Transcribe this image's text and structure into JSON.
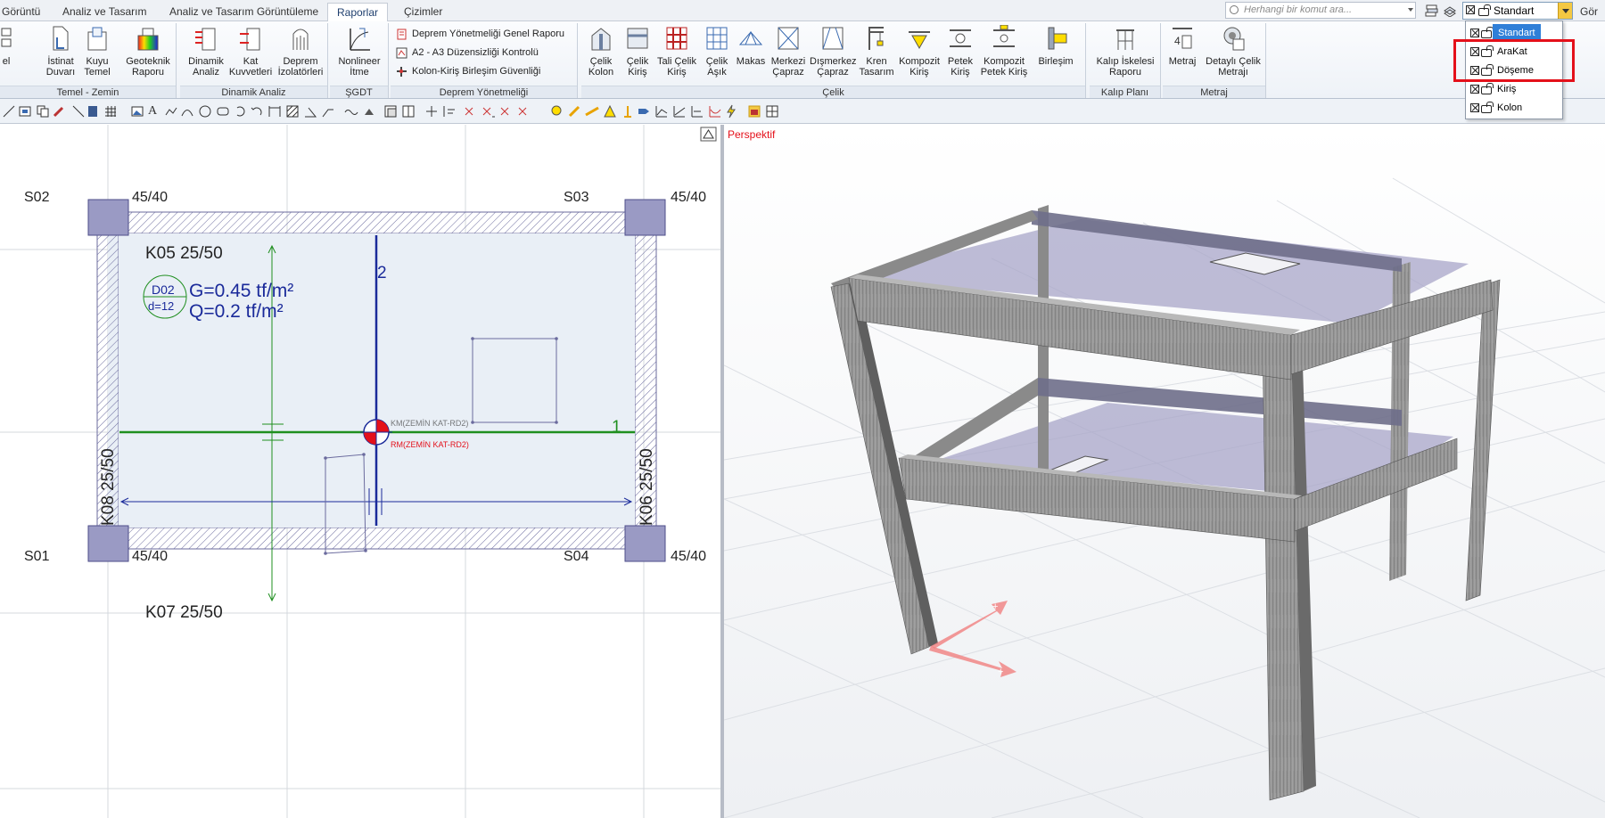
{
  "tabs": [
    {
      "label": "Görüntü",
      "active": false
    },
    {
      "label": "Analiz ve Tasarım",
      "active": false
    },
    {
      "label": "Analiz ve Tasarım Görüntüleme",
      "active": false
    },
    {
      "label": "Raporlar",
      "active": true
    },
    {
      "label": "Çizimler",
      "active": false
    }
  ],
  "search": {
    "placeholder": "Herhangi bir komut ara..."
  },
  "layer_combo": {
    "value": "Standart"
  },
  "gor_label": "Gör",
  "ribbon": {
    "temel": {
      "label": "Temel - Zemin",
      "buttons": [
        {
          "l1": "",
          "l2": "el"
        },
        {
          "l1": "İstinat",
          "l2": "Duvarı"
        },
        {
          "l1": "Kuyu",
          "l2": "Temel"
        },
        {
          "l1": "Geoteknik",
          "l2": "Raporu"
        }
      ]
    },
    "dinamik": {
      "label": "Dinamik Analiz",
      "buttons": [
        {
          "l1": "Dinamik",
          "l2": "Analiz"
        },
        {
          "l1": "Kat",
          "l2": "Kuvvetleri"
        },
        {
          "l1": "Deprem",
          "l2": "İzolatörleri"
        }
      ]
    },
    "sgdt": {
      "label": "ŞGDT",
      "buttons": [
        {
          "l1": "Nonlineer",
          "l2": "İtme"
        }
      ]
    },
    "deprem": {
      "label": "Deprem Yönetmeliği",
      "items": [
        "Deprem Yönetmeliği Genel Raporu",
        "A2 - A3 Düzensizliği Kontrolü",
        "Kolon-Kiriş Birleşim Güvenliği"
      ]
    },
    "celik": {
      "label": "Çelik",
      "buttons": [
        {
          "l1": "Çelik",
          "l2": "Kolon"
        },
        {
          "l1": "Çelik",
          "l2": "Kiriş"
        },
        {
          "l1": "Tali Çelik",
          "l2": "Kiriş"
        },
        {
          "l1": "Çelik",
          "l2": "Aşık"
        },
        {
          "l1": "Makas",
          "l2": ""
        },
        {
          "l1": "Merkezi",
          "l2": "Çapraz"
        },
        {
          "l1": "Dışmerkez",
          "l2": "Çapraz"
        },
        {
          "l1": "Kren",
          "l2": "Tasarım"
        },
        {
          "l1": "Kompozit",
          "l2": "Kiriş"
        },
        {
          "l1": "Petek",
          "l2": "Kiriş"
        },
        {
          "l1": "Kompozit",
          "l2": "Petek Kiriş"
        },
        {
          "l1": "Birleşim",
          "l2": ""
        }
      ]
    },
    "kalip": {
      "label": "Kalıp Planı",
      "buttons": [
        {
          "l1": "Kalıp İskelesi",
          "l2": "Raporu"
        }
      ]
    },
    "metraj": {
      "label": "Metraj",
      "buttons": [
        {
          "l1": "Metraj",
          "l2": ""
        },
        {
          "l1": "Detaylı Çelik",
          "l2": "Metrajı"
        }
      ]
    }
  },
  "dropdown": {
    "items": [
      {
        "label": "Standart",
        "selected": true
      },
      {
        "label": "AraKat",
        "selected": false
      },
      {
        "label": "Döşeme",
        "selected": false
      },
      {
        "label": "Kiriş",
        "selected": false
      },
      {
        "label": "Kolon",
        "selected": false
      }
    ]
  },
  "plan": {
    "columns": [
      {
        "name": "S02",
        "size": "45/40"
      },
      {
        "name": "S03",
        "size": "45/40"
      },
      {
        "name": "S01",
        "size": "45/40"
      },
      {
        "name": "S04",
        "size": "45/40"
      }
    ],
    "beams": {
      "top": "K05 25/50",
      "bottom": "K07 25/50",
      "left": "K08 25/50",
      "right": "K06 25/50"
    },
    "slab": {
      "name": "D02",
      "thickness": "d=12",
      "g": "G=0.45 tf/m²",
      "q": "Q=0.2 tf/m²"
    },
    "axes": {
      "horizontal": "1",
      "vertical": "2"
    },
    "rigidity_label": "RM(ZEMİN KAT-RD2)",
    "rigidity_label_shadow": "KM(ZEMİN KAT-RD2)"
  },
  "perspective": {
    "label": "Perspektif"
  },
  "colors": {
    "accent": "#2f7fd8",
    "highlight": "#e4101a",
    "axis1": "#1f8f1f",
    "axis2": "#1a2a9a"
  }
}
